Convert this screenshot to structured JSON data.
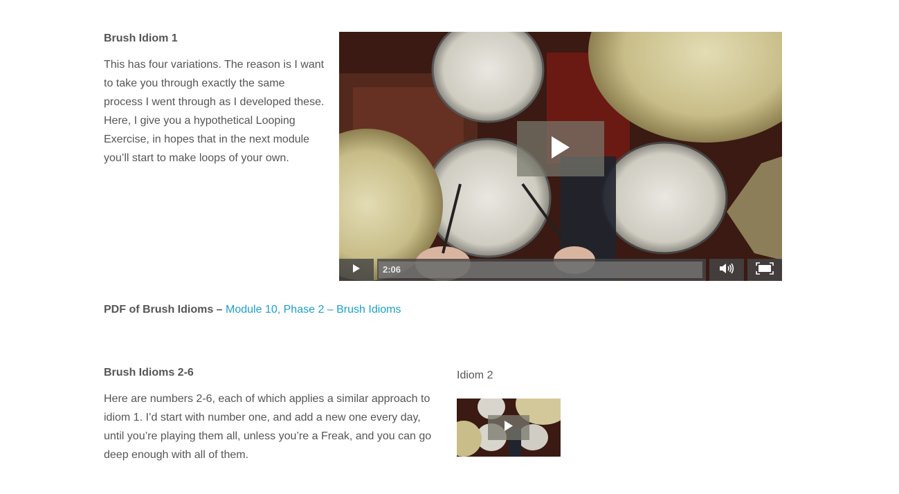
{
  "section1": {
    "title": "Brush Idiom 1",
    "body": "This has four variations. The reason is I want to take you through exactly the same process I went through as I developed these. Here, I give you a hypothetical Looping Exercise, in hopes that in the next module you’ll start to make loops of your own."
  },
  "video1": {
    "duration": "2:06",
    "icons": [
      "play-icon",
      "volume-icon",
      "fullscreen-icon"
    ]
  },
  "pdf": {
    "label": "PDF of Brush Idioms – ",
    "link_text": "Module 10, Phase 2 – Brush Idioms"
  },
  "section2": {
    "title": "Brush Idioms 2-6",
    "body": "Here are numbers 2-6, each of which applies a similar approach to idiom 1. I’d start with number one, and add a new one every day, until you’re playing them all, unless you’re a Freak, and you can go deep enough with all of them."
  },
  "video2": {
    "caption": "Idiom 2"
  },
  "colors": {
    "link": "#1ba1c9",
    "text": "#555555",
    "control_bg": "#464646"
  }
}
